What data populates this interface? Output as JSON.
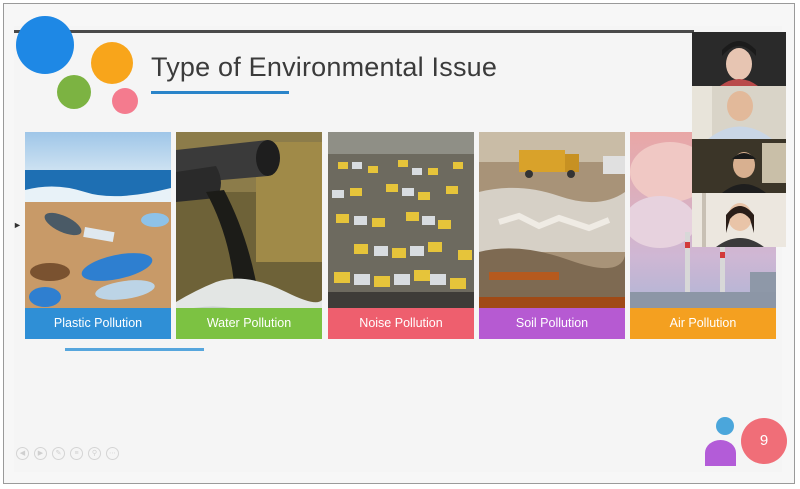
{
  "slide": {
    "title": "Type of Environmental Issue",
    "page_number": "9"
  },
  "cards": [
    {
      "label": "Plastic Pollution",
      "label_color": "#2f8fd6",
      "icon": "plastic-bottles-beach-photo"
    },
    {
      "label": "Water Pollution",
      "label_color": "#7cc242",
      "icon": "sewage-pipe-discharge-photo"
    },
    {
      "label": "Noise Pollution",
      "label_color": "#ee5f6e",
      "icon": "traffic-jam-photo"
    },
    {
      "label": "Soil Pollution",
      "label_color": "#b65ad2",
      "icon": "waste-dump-truck-photo"
    },
    {
      "label": "Air Pollution",
      "label_color": "#f4a020",
      "icon": "factory-smokestack-photo"
    }
  ],
  "participants": [
    {
      "name": "participant-1",
      "icon": "webcam-video-feed"
    },
    {
      "name": "participant-2",
      "icon": "webcam-video-feed"
    },
    {
      "name": "participant-3",
      "icon": "webcam-video-feed"
    },
    {
      "name": "participant-4",
      "icon": "webcam-video-feed"
    }
  ],
  "decor_colors": {
    "blue": "#1e88e5",
    "orange": "#f8a51b",
    "green": "#7cb342",
    "pink": "#f47b8e",
    "purple": "#b35cd8",
    "light_blue": "#4ba6db"
  },
  "toolbar_icons": [
    "prev-icon",
    "next-icon",
    "pen-icon",
    "menu-icon",
    "zoom-icon",
    "more-icon"
  ]
}
